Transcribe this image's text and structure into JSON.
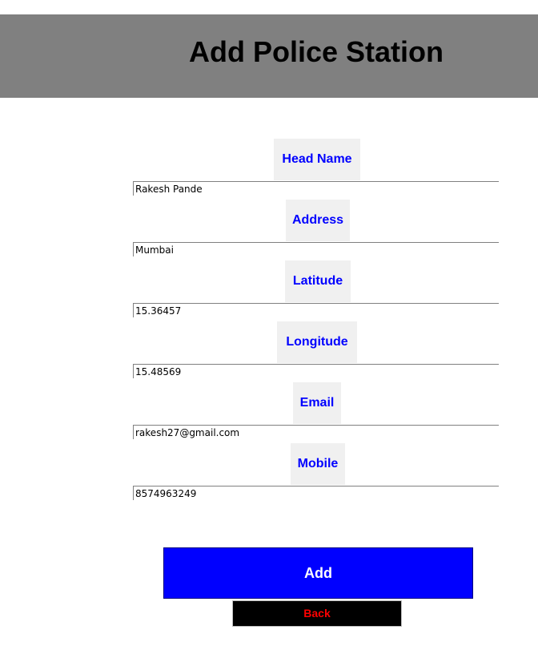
{
  "header": {
    "title": "Add Police Station",
    "background": "#808080"
  },
  "form": {
    "fields": [
      {
        "label": "Head Name",
        "value": "Rakesh Pande"
      },
      {
        "label": "Address",
        "value": "Mumbai"
      },
      {
        "label": "Latitude",
        "value": "15.36457"
      },
      {
        "label": "Longitude",
        "value": "15.48569"
      },
      {
        "label": "Email",
        "value": "rakesh27@gmail.com"
      },
      {
        "label": "Mobile",
        "value": "8574963249"
      }
    ],
    "label_color": "#0000ff"
  },
  "actions": {
    "add_label": "Add",
    "add_color": "#0000ff",
    "back_label": "Back",
    "back_color": "#ff0000"
  }
}
